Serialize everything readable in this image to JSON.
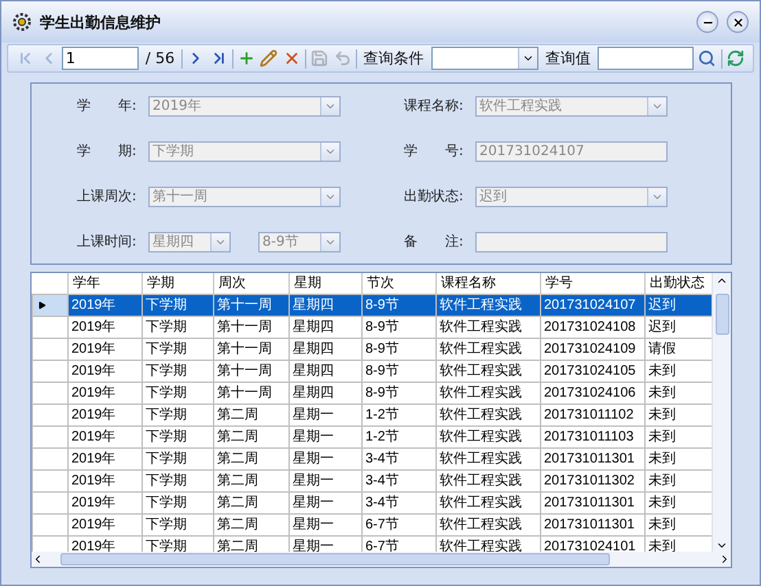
{
  "window": {
    "title": "学生出勤信息维护",
    "buttons": [
      {
        "kind": "minimize"
      },
      {
        "kind": "close"
      }
    ]
  },
  "toolbar": {
    "items": [
      {
        "kind": "first",
        "disabled": true
      },
      {
        "kind": "prev",
        "disabled": true
      },
      {
        "kind": "page",
        "value": "1"
      },
      {
        "kind": "label",
        "text": "/ 56"
      },
      {
        "kind": "sep"
      },
      {
        "kind": "next",
        "disabled": false
      },
      {
        "kind": "last",
        "disabled": false
      },
      {
        "kind": "sep"
      },
      {
        "kind": "add",
        "disabled": false
      },
      {
        "kind": "edit",
        "disabled": false
      },
      {
        "kind": "delete",
        "disabled": false
      },
      {
        "kind": "sep"
      },
      {
        "kind": "save",
        "disabled": true
      },
      {
        "kind": "undo",
        "disabled": true
      },
      {
        "kind": "sep"
      },
      {
        "kind": "label",
        "text": "查询条件"
      },
      {
        "kind": "combo",
        "value": ""
      },
      {
        "kind": "label",
        "text": "查询值"
      },
      {
        "kind": "input",
        "value": ""
      },
      {
        "kind": "search",
        "disabled": false
      },
      {
        "kind": "sep"
      },
      {
        "kind": "refresh",
        "disabled": false
      }
    ]
  },
  "form": {
    "fields": [
      {
        "label": "学　　年:",
        "inputs": [
          {
            "kind": "combo",
            "value": "2019年",
            "disabled": true
          }
        ]
      },
      {
        "label": "课程名称:",
        "inputs": [
          {
            "kind": "combo",
            "value": "软件工程实践",
            "disabled": true
          }
        ]
      },
      {
        "label": "学　　期:",
        "inputs": [
          {
            "kind": "combo",
            "value": "下学期",
            "disabled": true
          }
        ]
      },
      {
        "label": "学　　号:",
        "inputs": [
          {
            "kind": "text",
            "value": "201731024107",
            "disabled": true
          }
        ]
      },
      {
        "label": "上课周次:",
        "inputs": [
          {
            "kind": "combo",
            "value": "第十一周",
            "disabled": true
          }
        ]
      },
      {
        "label": "出勤状态:",
        "inputs": [
          {
            "kind": "combo",
            "value": "迟到",
            "disabled": true
          }
        ]
      },
      {
        "label": "上课时间:",
        "inputs": [
          {
            "kind": "combo",
            "value": "星期四",
            "disabled": true
          },
          {
            "kind": "combo",
            "value": "8-9节",
            "disabled": true
          }
        ]
      },
      {
        "label": "备　　注:",
        "inputs": [
          {
            "kind": "text",
            "disabled": true
          }
        ]
      }
    ]
  },
  "table": {
    "columns": [
      "学年",
      "学期",
      "周次",
      "星期",
      "节次",
      "课程名称",
      "学号",
      "出勤状态"
    ],
    "rows": [
      {
        "selected": true,
        "cells": [
          "2019年",
          "下学期",
          "第十一周",
          "星期四",
          "8-9节",
          "软件工程实践",
          "201731024107",
          "迟到"
        ]
      },
      {
        "selected": false,
        "cells": [
          "2019年",
          "下学期",
          "第十一周",
          "星期四",
          "8-9节",
          "软件工程实践",
          "201731024108",
          "迟到"
        ]
      },
      {
        "selected": false,
        "cells": [
          "2019年",
          "下学期",
          "第十一周",
          "星期四",
          "8-9节",
          "软件工程实践",
          "201731024109",
          "请假"
        ]
      },
      {
        "selected": false,
        "cells": [
          "2019年",
          "下学期",
          "第十一周",
          "星期四",
          "8-9节",
          "软件工程实践",
          "201731024105",
          "未到"
        ]
      },
      {
        "selected": false,
        "cells": [
          "2019年",
          "下学期",
          "第十一周",
          "星期四",
          "8-9节",
          "软件工程实践",
          "201731024106",
          "未到"
        ]
      },
      {
        "selected": false,
        "cells": [
          "2019年",
          "下学期",
          "第二周",
          "星期一",
          "1-2节",
          "软件工程实践",
          "201731011102",
          "未到"
        ]
      },
      {
        "selected": false,
        "cells": [
          "2019年",
          "下学期",
          "第二周",
          "星期一",
          "1-2节",
          "软件工程实践",
          "201731011103",
          "未到"
        ]
      },
      {
        "selected": false,
        "cells": [
          "2019年",
          "下学期",
          "第二周",
          "星期一",
          "3-4节",
          "软件工程实践",
          "201731011301",
          "未到"
        ]
      },
      {
        "selected": false,
        "cells": [
          "2019年",
          "下学期",
          "第二周",
          "星期一",
          "3-4节",
          "软件工程实践",
          "201731011302",
          "未到"
        ]
      },
      {
        "selected": false,
        "cells": [
          "2019年",
          "下学期",
          "第二周",
          "星期一",
          "3-4节",
          "软件工程实践",
          "201731011301",
          "未到"
        ]
      },
      {
        "selected": false,
        "cells": [
          "2019年",
          "下学期",
          "第二周",
          "星期一",
          "6-7节",
          "软件工程实践",
          "201731011301",
          "未到"
        ]
      },
      {
        "selected": false,
        "cells": [
          "2019年",
          "下学期",
          "第二周",
          "星期一",
          "6-7节",
          "软件工程实践",
          "201731024101",
          "未到"
        ]
      }
    ]
  }
}
